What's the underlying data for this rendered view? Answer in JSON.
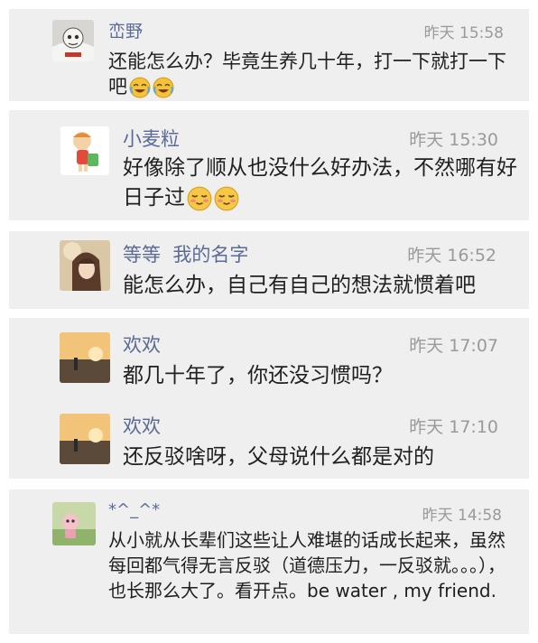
{
  "comments": [
    {
      "name": "峦野",
      "time": "昨天 15:58",
      "text": "还能怎么办？毕竟生养几十年，打一下就打一下吧",
      "emojis": [
        "laugh-cry-emoji",
        "laugh-cry-emoji"
      ]
    },
    {
      "name": "小麦粒",
      "time": "昨天 15:30",
      "text": "好像除了顺从也没什么好办法，不然哪有好日子过",
      "emojis": [
        "sly-smile-emoji",
        "sly-smile-emoji"
      ]
    },
    {
      "name": "等等  我的名字",
      "time": "昨天 16:52",
      "text": "能怎么办，自己有自己的想法就惯着吧"
    },
    {
      "name": "欢欢",
      "time": "昨天 17:07",
      "text": "都几十年了，你还没习惯吗？"
    },
    {
      "name": "欢欢",
      "time": "昨天 17:10",
      "text": "还反驳啥呀，父母说什么都是对的"
    },
    {
      "name": "*^_^*",
      "time": "昨天 14:58",
      "text": "从小就从长辈们这些让人难堪的话成长起来，虽然每回都气得无言反驳（道德压力，一反驳就。。。），也长那么大了。看开点。be water , my friend."
    }
  ]
}
